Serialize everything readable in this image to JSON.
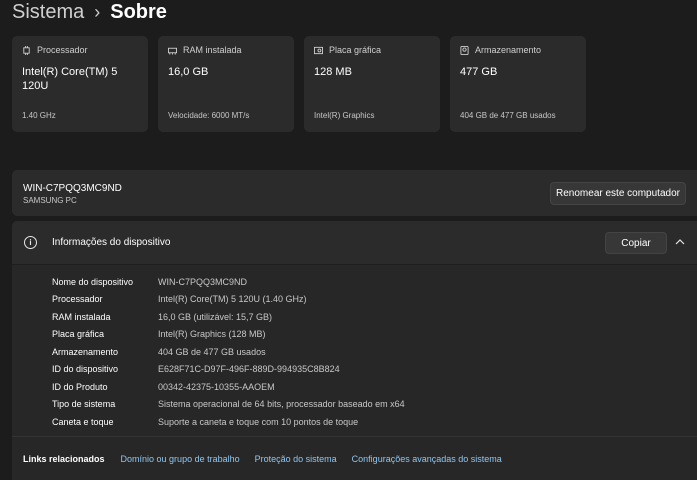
{
  "breadcrumb": {
    "parent": "Sistema",
    "separator": "›",
    "current": "Sobre"
  },
  "cards": [
    {
      "icon": "processor-icon",
      "label": "Processador",
      "value": "Intel(R) Core(TM) 5 120U",
      "sub": "1.40 GHz"
    },
    {
      "icon": "ram-icon",
      "label": "RAM instalada",
      "value": "16,0 GB",
      "sub": "Velocidade: 6000 MT/s"
    },
    {
      "icon": "graphics-card-icon",
      "label": "Placa gráfica",
      "value": "128 MB",
      "sub": "Intel(R) Graphics"
    },
    {
      "icon": "storage-icon",
      "label": "Armazenamento",
      "value": "477 GB",
      "sub": "404 GB de 477 GB usados"
    }
  ],
  "device": {
    "name": "WIN-C7PQQ3MC9ND",
    "model": "SAMSUNG PC",
    "rename_label": "Renomear este computador"
  },
  "info": {
    "title": "Informações do dispositivo",
    "copy_label": "Copiar",
    "specs": [
      {
        "label": "Nome do dispositivo",
        "value": "WIN-C7PQQ3MC9ND"
      },
      {
        "label": "Processador",
        "value": "Intel(R) Core(TM) 5 120U (1.40 GHz)"
      },
      {
        "label": "RAM instalada",
        "value": "16,0 GB (utilizável: 15,7 GB)"
      },
      {
        "label": "Placa gráfica",
        "value": "Intel(R) Graphics (128 MB)"
      },
      {
        "label": "Armazenamento",
        "value": "404 GB de 477 GB usados"
      },
      {
        "label": "ID do dispositivo",
        "value": "E628F71C-D97F-496F-889D-994935C8B824"
      },
      {
        "label": "ID do Produto",
        "value": "00342-42375-10355-AAOEM"
      },
      {
        "label": "Tipo de sistema",
        "value": "Sistema operacional de 64 bits, processador baseado em x64"
      },
      {
        "label": "Caneta e toque",
        "value": "Suporte a caneta e toque com 10 pontos de toque"
      }
    ]
  },
  "related_links": {
    "label": "Links relacionados",
    "items": [
      "Domínio ou grupo de trabalho",
      "Proteção do sistema",
      "Configurações avançadas do sistema"
    ]
  },
  "colors": {
    "background": "#1c1c1c",
    "card": "#2b2b2b",
    "link": "#8ec7f2"
  }
}
